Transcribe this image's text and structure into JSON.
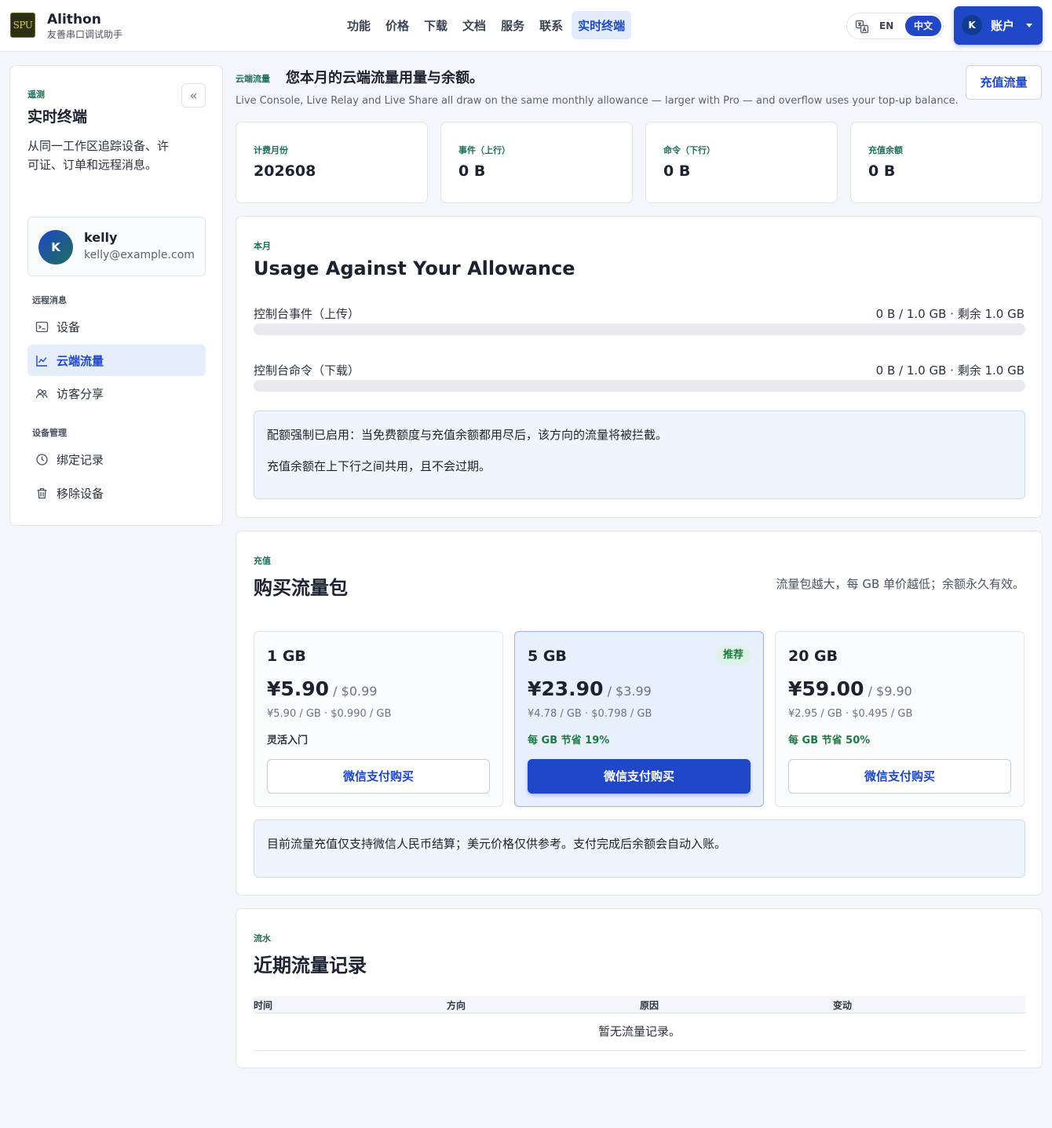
{
  "brand": {
    "logo_text": "SPU",
    "name": "Alithon",
    "subtitle": "友善串口调试助手"
  },
  "nav": {
    "items": [
      "功能",
      "价格",
      "下载",
      "文档",
      "服务",
      "联系",
      "实时终端"
    ],
    "active": "实时终端"
  },
  "lang": {
    "en": "EN",
    "zh": "中文",
    "active": "中文"
  },
  "account": {
    "initial": "K",
    "label": "账户"
  },
  "sidebar": {
    "eyebrow": "遥测",
    "title": "实时终端",
    "description": "从同一工作区追踪设备、许可证、订单和远程消息。",
    "collapse_icon": "«",
    "user": {
      "initial": "K",
      "name": "kelly",
      "email": "kelly@example.com"
    },
    "section_remote": "远程消息",
    "remote_items": [
      {
        "label": "设备",
        "icon": "terminal-icon"
      },
      {
        "label": "云端流量",
        "icon": "chart-line-icon",
        "active": true
      },
      {
        "label": "访客分享",
        "icon": "users-icon"
      }
    ],
    "section_device": "设备管理",
    "device_items": [
      {
        "label": "绑定记录",
        "icon": "clock-icon"
      },
      {
        "label": "移除设备",
        "icon": "trash-icon"
      }
    ]
  },
  "usage": {
    "eyebrow": "云端流量",
    "heading": "您本月的云端流量用量与余额。",
    "description": "Live Console, Live Relay and Live Share all draw on the same monthly allowance — larger with Pro — and overflow uses your top-up balance.",
    "topup_button": "充值流量"
  },
  "stats": [
    {
      "label": "计费月份",
      "value": "202608"
    },
    {
      "label": "事件（上行）",
      "value": "0 B"
    },
    {
      "label": "命令（下行）",
      "value": "0 B"
    },
    {
      "label": "充值余额",
      "value": "0 B"
    }
  ],
  "allowance": {
    "eyebrow": "本月",
    "title": "Usage Against Your Allowance",
    "meters": [
      {
        "label": "控制台事件（上传）",
        "value": "0 B / 1.0 GB · 剩余 1.0 GB",
        "fraction": 0
      },
      {
        "label": "控制台命令（下载）",
        "value": "0 B / 1.0 GB · 剩余 1.0 GB",
        "fraction": 0
      }
    ],
    "notice_1": "配额强制已启用：当免费额度与充值余额都用尽后，该方向的流量将被拦截。",
    "notice_2": "充值余额在上下行之间共用，且不会过期。"
  },
  "packs": {
    "eyebrow": "充值",
    "title": "购买流量包",
    "hint": "流量包越大，每 GB 单价越低；余额永久有效。",
    "items": [
      {
        "size": "1 GB",
        "price": "¥5.90",
        "usd": " / $0.99",
        "unit": "¥5.90 / GB · $0.990 / GB",
        "note": "灵活入门",
        "save": false,
        "badge": "",
        "button": "微信支付购买",
        "featured": false
      },
      {
        "size": "5 GB",
        "price": "¥23.90",
        "usd": " / $3.99",
        "unit": "¥4.78 / GB · $0.798 / GB",
        "note": "每 GB 节省 19%",
        "save": true,
        "badge": "推荐",
        "button": "微信支付购买",
        "featured": true
      },
      {
        "size": "20 GB",
        "price": "¥59.00",
        "usd": " / $9.90",
        "unit": "¥2.95 / GB · $0.495 / GB",
        "note": "每 GB 节省 50%",
        "save": true,
        "badge": "",
        "button": "微信支付购买",
        "featured": false
      }
    ],
    "notice": "目前流量充值仅支持微信人民币结算；美元价格仅供参考。支付完成后余额会自动入账。"
  },
  "ledger": {
    "eyebrow": "流水",
    "title": "近期流量记录",
    "columns": [
      "时间",
      "方向",
      "原因",
      "变动"
    ],
    "empty": "暂无流量记录。"
  }
}
